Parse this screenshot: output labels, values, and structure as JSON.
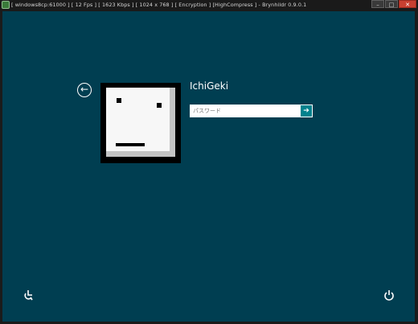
{
  "window": {
    "title": "[ windows8cp:61000 ] [ 12 Fps ] [ 1623 Kbps ] [ 1024 x 768 ] [ Encryption ] [HighCompress ] - Brynhildr 0.9.0.1",
    "minimize_label": "–",
    "maximize_label": "□",
    "close_label": "✕"
  },
  "login": {
    "back_glyph": "←",
    "username": "IchiGeki",
    "password_placeholder": "パスワード",
    "password_value": "",
    "submit_glyph": "➔"
  },
  "footer": {
    "ease_of_access_icon": "ease-of-access-icon",
    "power_icon": "power-icon"
  },
  "colors": {
    "background": "#003e51",
    "submit_button": "#00818d",
    "titlebar": "#1a1a1a"
  }
}
